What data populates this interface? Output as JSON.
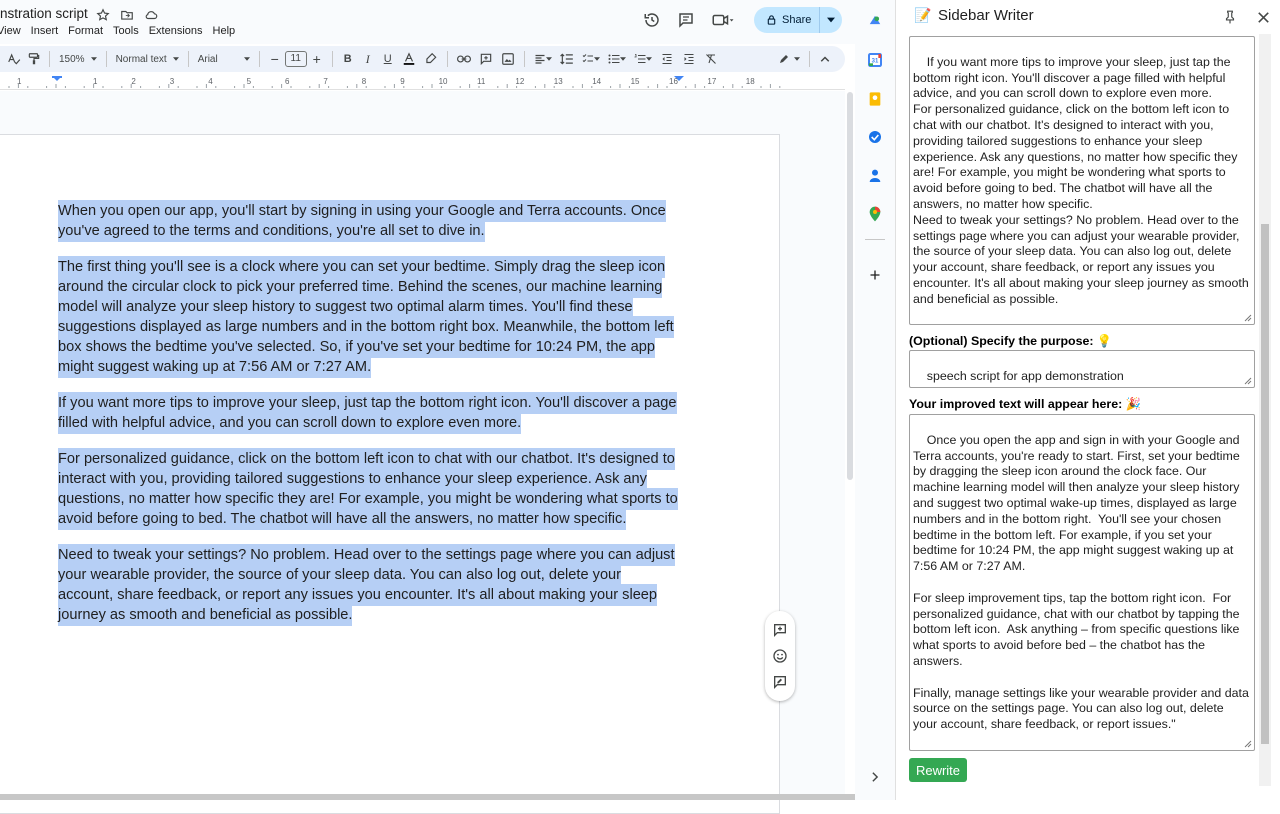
{
  "header": {
    "doc_title": "nstration script",
    "menu": [
      "View",
      "Insert",
      "Format",
      "Tools",
      "Extensions",
      "Help"
    ],
    "share_label": "Share"
  },
  "toolbar": {
    "zoom": "150%",
    "style": "Normal text",
    "font": "Arial",
    "font_size": "11"
  },
  "ruler": {
    "numbers": [
      "1",
      "1",
      "2",
      "3",
      "4",
      "5",
      "6",
      "7",
      "8",
      "9",
      "10",
      "11",
      "12",
      "13",
      "14",
      "15",
      "16",
      "17",
      "18"
    ]
  },
  "document": {
    "paragraphs": [
      "When you open our app, you'll start by signing in using your Google and Terra accounts. Once you've agreed to the terms and conditions, you're all set to dive in.",
      "The first thing you'll see is a clock where you can set your bedtime. Simply drag the sleep icon around the circular clock to pick your preferred time. Behind the scenes, our machine learning model will analyze your sleep history to suggest two optimal alarm times. You'll find these suggestions displayed as large numbers and in the bottom right box. Meanwhile, the bottom left box shows the bedtime you've selected. So, if you've set your bedtime for 10:24 PM, the app might suggest waking up at 7:56 AM or 7:27 AM.",
      "If you want more tips to improve your sleep, just tap the bottom right icon. You'll discover a page filled with helpful advice, and you can scroll down to explore even more.",
      "For personalized guidance, click on the bottom left icon to chat with our chatbot. It's designed to interact with you, providing tailored suggestions to enhance your sleep experience. Ask any questions, no matter how specific they are! For example, you might be wondering what sports to avoid before going to bed. The chatbot will have all the answers, no matter how specific.",
      "Need to tweak your settings? No problem. Head over to the settings page where you can adjust your wearable provider, the source of your sleep data. You can also log out, delete your account, share feedback, or report any issues you encounter. It's all about making your sleep journey as smooth and beneficial as possible."
    ]
  },
  "sidebar": {
    "emoji": "📝",
    "title": "Sidebar Writer",
    "input_text": "If you want more tips to improve your sleep, just tap the bottom right icon. You'll discover a page filled with helpful advice, and you can scroll down to explore even more.\nFor personalized guidance, click on the bottom left icon to chat with our chatbot. It's designed to interact with you, providing tailored suggestions to enhance your sleep experience. Ask any questions, no matter how specific they are! For example, you might be wondering what sports to avoid before going to bed. The chatbot will have all the answers, no matter how specific.\nNeed to tweak your settings? No problem. Head over to the settings page where you can adjust your wearable provider, the source of your sleep data. You can also log out, delete your account, share feedback, or report any issues you encounter. It's all about making your sleep journey as smooth and beneficial as possible.",
    "purpose_label": "(Optional) Specify the purpose: 💡",
    "purpose_value": "speech script for app demonstration",
    "output_label": "Your improved text will appear here: 🎉",
    "output_text": "Once you open the app and sign in with your Google and Terra accounts, you're ready to start. First, set your bedtime by dragging the sleep icon around the clock face. Our machine learning model will then analyze your sleep history and suggest two optimal wake-up times, displayed as large numbers and in the bottom right.  You'll see your chosen bedtime in the bottom left. For example, if you set your bedtime for 10:24 PM, the app might suggest waking up at 7:56 AM or 7:27 AM.\n\nFor sleep improvement tips, tap the bottom right icon.  For personalized guidance, chat with our chatbot by tapping the bottom left icon.  Ask anything – from specific questions like what sports to avoid before bed – the chatbot has the answers.\n\nFinally, manage settings like your wearable provider and data source on the settings page. You can also log out, delete your account, share feedback, or report issues.\"",
    "rewrite_label": "Rewrite"
  },
  "colors": {
    "selection": "#b6cff5",
    "share_bg": "#c2e7ff",
    "rewrite_bg": "#34a853"
  }
}
